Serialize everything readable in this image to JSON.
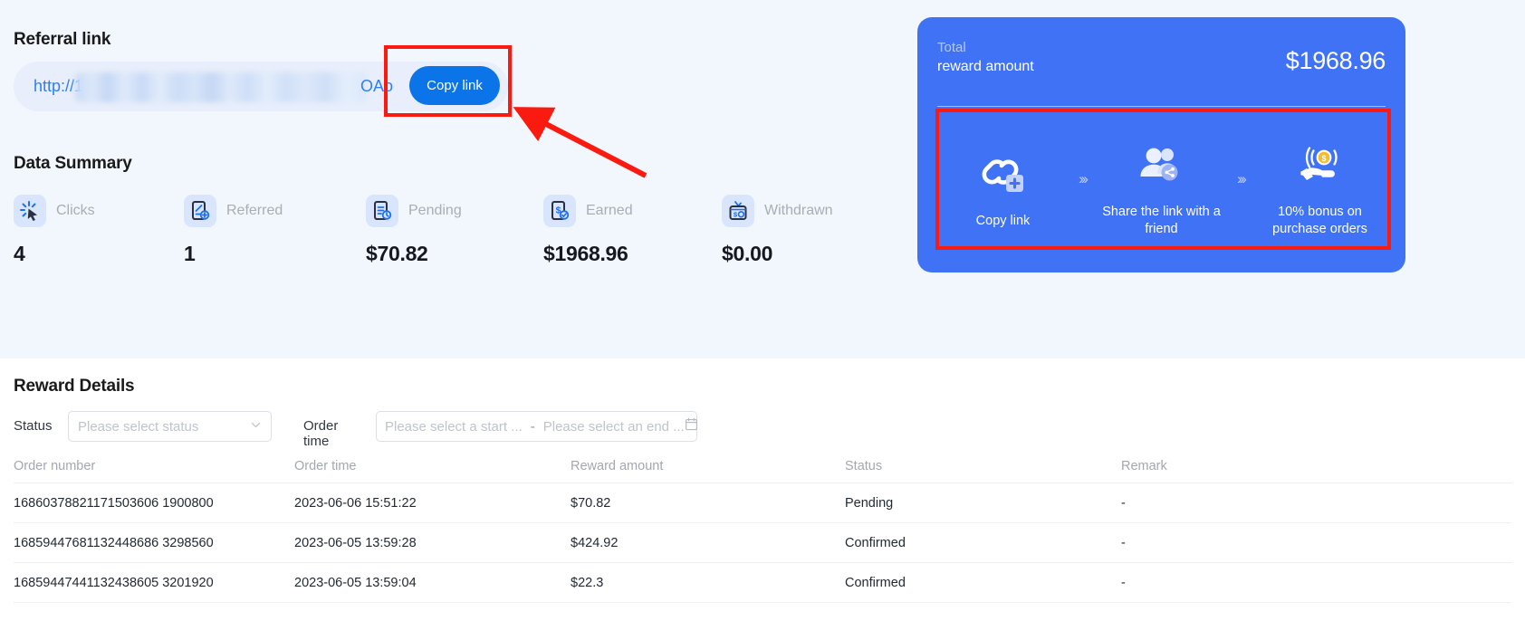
{
  "referral": {
    "title": "Referral link",
    "link_prefix": "http://1",
    "link_suffix": "OAo",
    "copy_button": "Copy link"
  },
  "summary": {
    "title": "Data Summary",
    "items": [
      {
        "label": "Clicks",
        "value": "4",
        "icon": "cursor-click-icon"
      },
      {
        "label": "Referred",
        "value": "1",
        "icon": "user-add-icon"
      },
      {
        "label": "Pending",
        "value": "$70.82",
        "icon": "clock-document-icon"
      },
      {
        "label": "Earned",
        "value": "$1968.96",
        "icon": "dollar-check-icon"
      },
      {
        "label": "Withdrawn",
        "value": "$0.00",
        "icon": "wallet-icon"
      }
    ]
  },
  "reward_card": {
    "total_label": "Total",
    "total_sub_label": "reward amount",
    "amount": "$1968.96",
    "separator": "›››",
    "steps": [
      {
        "label": "Copy link",
        "icon": "link-add-icon"
      },
      {
        "label": "Share the link with a friend",
        "icon": "users-share-icon"
      },
      {
        "label": "10% bonus on purchase orders",
        "icon": "hand-coin-icon"
      }
    ],
    "accent_color": "#4072f5"
  },
  "details": {
    "title": "Reward Details",
    "status_label": "Status",
    "status_placeholder": "Please select status",
    "order_time_label": "Order time",
    "start_placeholder": "Please select a start ...",
    "range_separator": "-",
    "end_placeholder": "Please select an end ...",
    "columns": [
      "Order number",
      "Order time",
      "Reward amount",
      "Status",
      "Remark"
    ],
    "rows": [
      {
        "order_number": "16860378821171503606 1900800",
        "order_time": "2023-06-06 15:51:22",
        "reward_amount": "$70.82",
        "status": "Pending",
        "remark": "-"
      },
      {
        "order_number": "16859447681132448686 3298560",
        "order_time": "2023-06-05 13:59:28",
        "reward_amount": "$424.92",
        "status": "Confirmed",
        "remark": "-"
      },
      {
        "order_number": "16859447441132438605 3201920",
        "order_time": "2023-06-05 13:59:04",
        "reward_amount": "$22.3",
        "status": "Confirmed",
        "remark": "-"
      }
    ]
  },
  "annotations": {
    "highlight_color": "#fb1a10",
    "boxes": [
      "copy-link-button",
      "referral-steps"
    ],
    "arrow": "points-to-copy-link-button"
  }
}
